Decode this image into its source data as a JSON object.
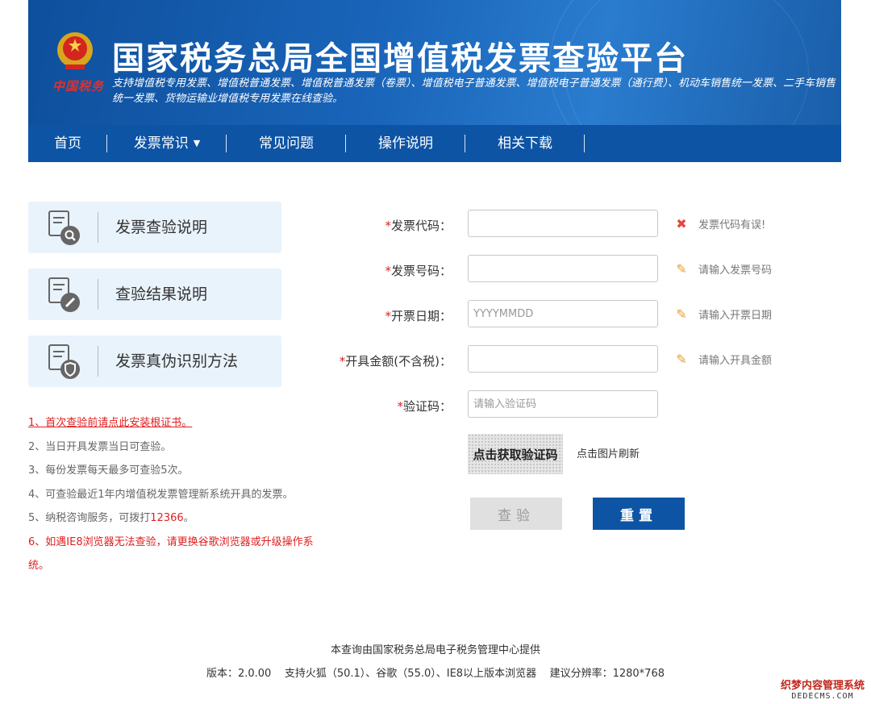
{
  "header": {
    "brand": "中国税务",
    "title": "国家税务总局全国增值税发票查验平台",
    "subtitle": "支持增值税专用发票、增值税普通发票、增值税普通发票（卷票）、增值税电子普通发票、增值税电子普通发票（通行费）、机动车销售统一发票、二手车销售统一发票、货物运输业增值税专用发票在线查验。"
  },
  "nav": {
    "items": [
      {
        "label": "首页"
      },
      {
        "label": "发票常识",
        "has_dropdown": true
      },
      {
        "label": "常见问题"
      },
      {
        "label": "操作说明"
      },
      {
        "label": "相关下载"
      }
    ]
  },
  "sidebar": {
    "buttons": [
      {
        "label": "发票查验说明",
        "icon": "document-search-icon"
      },
      {
        "label": "查验结果说明",
        "icon": "document-edit-icon"
      },
      {
        "label": "发票真伪识别方法",
        "icon": "document-shield-icon"
      }
    ]
  },
  "notes": [
    "1、首次查验前请点此安装根证书。",
    "2、当日开具发票当日可查验。",
    "3、每份发票每天最多可查验5次。",
    "4、可查验最近1年内增值税发票管理新系统开具的发票。",
    "5、纳税咨询服务，可拨打",
    "12366",
    "。",
    "6、如遇IE8浏览器无法查验，请更换谷歌浏览器或升级操作系统。"
  ],
  "form": {
    "required_mark": "*",
    "invoice_code": {
      "label": "发票代码：",
      "value": "",
      "hint": "发票代码有误!",
      "hint_icon": "error-x-icon"
    },
    "invoice_number": {
      "label": "发票号码：",
      "value": "",
      "hint": "请输入发票号码",
      "hint_icon": "pencil-icon"
    },
    "invoice_date": {
      "label": "开票日期：",
      "placeholder": "YYYYMMDD",
      "hint": "请输入开票日期",
      "hint_icon": "pencil-icon"
    },
    "amount": {
      "label": "开具金额(不含税)：",
      "value": "",
      "hint": "请输入开具金额",
      "hint_icon": "pencil-icon"
    },
    "captcha_code": {
      "label": "验证码：",
      "placeholder": "请输入验证码"
    },
    "captcha_image_text": "点击获取验证码",
    "captcha_refresh_hint": "点击图片刷新",
    "query_label": "查验",
    "reset_label": "重置"
  },
  "footer": {
    "provider": "本查询由国家税务总局电子税务管理中心提供",
    "version_info": "版本：2.0.00    支持火狐（50.1）、谷歌（55.0）、IE8以上版本浏览器    建议分辨率：1280*768"
  },
  "watermark": {
    "line1": "织梦内容管理系统",
    "line2": "DEDECMS.COM"
  },
  "colors": {
    "primary": "#0d54a5",
    "error": "#e02020",
    "side_bg": "#e9f3fc"
  }
}
